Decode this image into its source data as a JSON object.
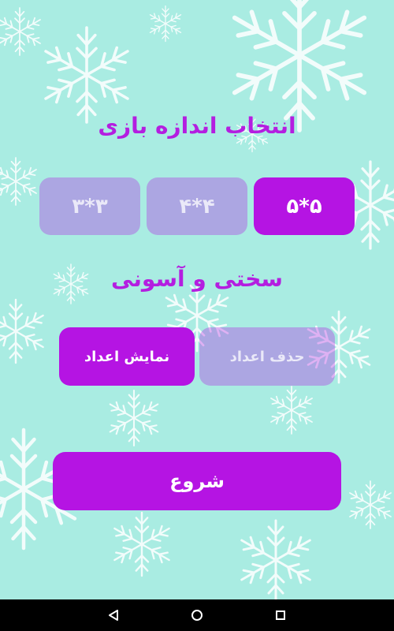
{
  "colors": {
    "accent": "#b514e3",
    "title": "#b41ee0",
    "background": "#a9ece2"
  },
  "size_section": {
    "title": "انتخاب اندازه بازی",
    "options": [
      {
        "label": "۳*۳",
        "selected": false
      },
      {
        "label": "۴*۴",
        "selected": false
      },
      {
        "label": "۵*۵",
        "selected": true
      }
    ]
  },
  "difficulty_section": {
    "title": "سختی و آسونی",
    "options": [
      {
        "label": "نمایش اعداد",
        "selected": true
      },
      {
        "label": "حذف اعداد",
        "selected": false
      }
    ]
  },
  "start_button": {
    "label": "شروع"
  },
  "navbar": {
    "icons": [
      "back-icon",
      "home-icon",
      "recents-icon"
    ]
  }
}
